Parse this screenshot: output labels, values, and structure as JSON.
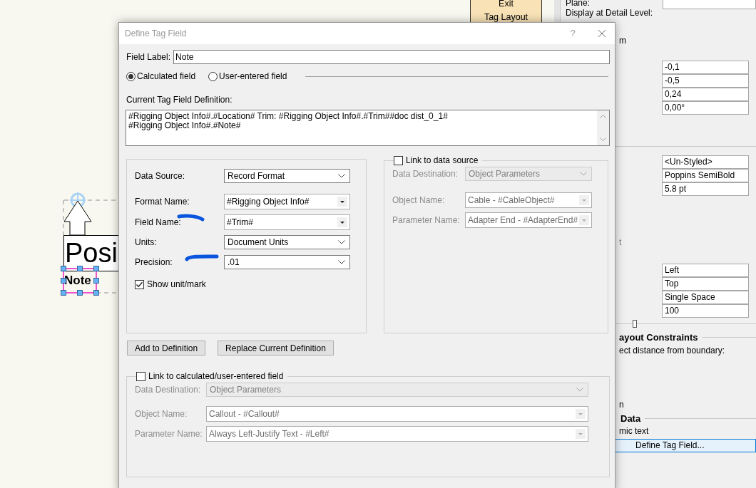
{
  "canvas": {
    "tag_texts": [
      {
        "text": "Posi",
        "selected": false
      },
      {
        "text": "Note",
        "selected": true
      }
    ]
  },
  "mode_button": {
    "lines": [
      "Exit",
      "Tag Layout"
    ]
  },
  "object_info": {
    "plane_label": "Plane:",
    "detail_label": "Display at Detail Level:",
    "cut_label_1": "m",
    "offset_fields": [
      "-0,1",
      "-0,5",
      "0,24",
      "0,00°"
    ],
    "text_fields": [
      "<Un-Styled>",
      "Poppins SemiBold",
      "5.8 pt"
    ],
    "cut_label_2": "t",
    "layout_fields": [
      "Left",
      "Top",
      "Single Space",
      "100"
    ],
    "slider": {
      "level": 0.18
    },
    "constraints_heading": "ayout Constraints",
    "constraints_label": "ect distance from boundary:",
    "cut_label_3": "n",
    "data_heading": "Data",
    "data_label": "mic text",
    "define_button": "Define Tag Field..."
  },
  "dialog": {
    "title": "Define Tag Field",
    "help_button": "?",
    "field_label": {
      "label": "Field Label:",
      "value": "Note"
    },
    "field_type": [
      {
        "label": "Calculated field",
        "selected": true
      },
      {
        "label": "User-entered field",
        "selected": false
      }
    ],
    "definition": {
      "label": "Current Tag Field Definition:",
      "lines": [
        "#Rigging Object Info#.#Location# Trim: #Rigging Object Info#.#Trim##doc dist_0_1#",
        "#Rigging Object Info#.#Note#"
      ]
    },
    "source_rows": [
      {
        "label": "Data Source:",
        "value": "Record Format",
        "kind": "select"
      },
      {
        "label": "Format Name:",
        "value": "#Rigging Object Info#",
        "kind": "combo"
      },
      {
        "label": "Field Name:",
        "value": "#Trim#",
        "kind": "combo"
      },
      {
        "label": "Units:",
        "value": "Document Units",
        "kind": "select"
      },
      {
        "label": "Precision:",
        "value": ".01",
        "kind": "select"
      }
    ],
    "show_unit": {
      "label": "Show unit/mark",
      "checked": true
    },
    "link_source": {
      "label": "Link to data source",
      "checked": false,
      "disabled": true,
      "rows": [
        {
          "label": "Data Destination:",
          "value": "Object Parameters",
          "kind": "select"
        },
        {
          "label": "Object Name:",
          "value": "Cable - #CableObject#",
          "kind": "combo"
        },
        {
          "label": "Parameter Name:",
          "value": "Adapter End - #AdapterEnd#",
          "kind": "combo"
        }
      ]
    },
    "buttons": [
      "Add to Definition",
      "Replace Current Definition"
    ],
    "link_field": {
      "label": "Link to calculated/user-entered field",
      "checked": false,
      "disabled": true,
      "rows": [
        {
          "label": "Data Destination:",
          "value": "Object Parameters",
          "kind": "select"
        },
        {
          "label": "Object Name:",
          "value": "Callout - #Callout#",
          "kind": "combo"
        },
        {
          "label": "Parameter Name:",
          "value": "Always Left-Justify Text - #Left#",
          "kind": "combo"
        }
      ]
    }
  }
}
